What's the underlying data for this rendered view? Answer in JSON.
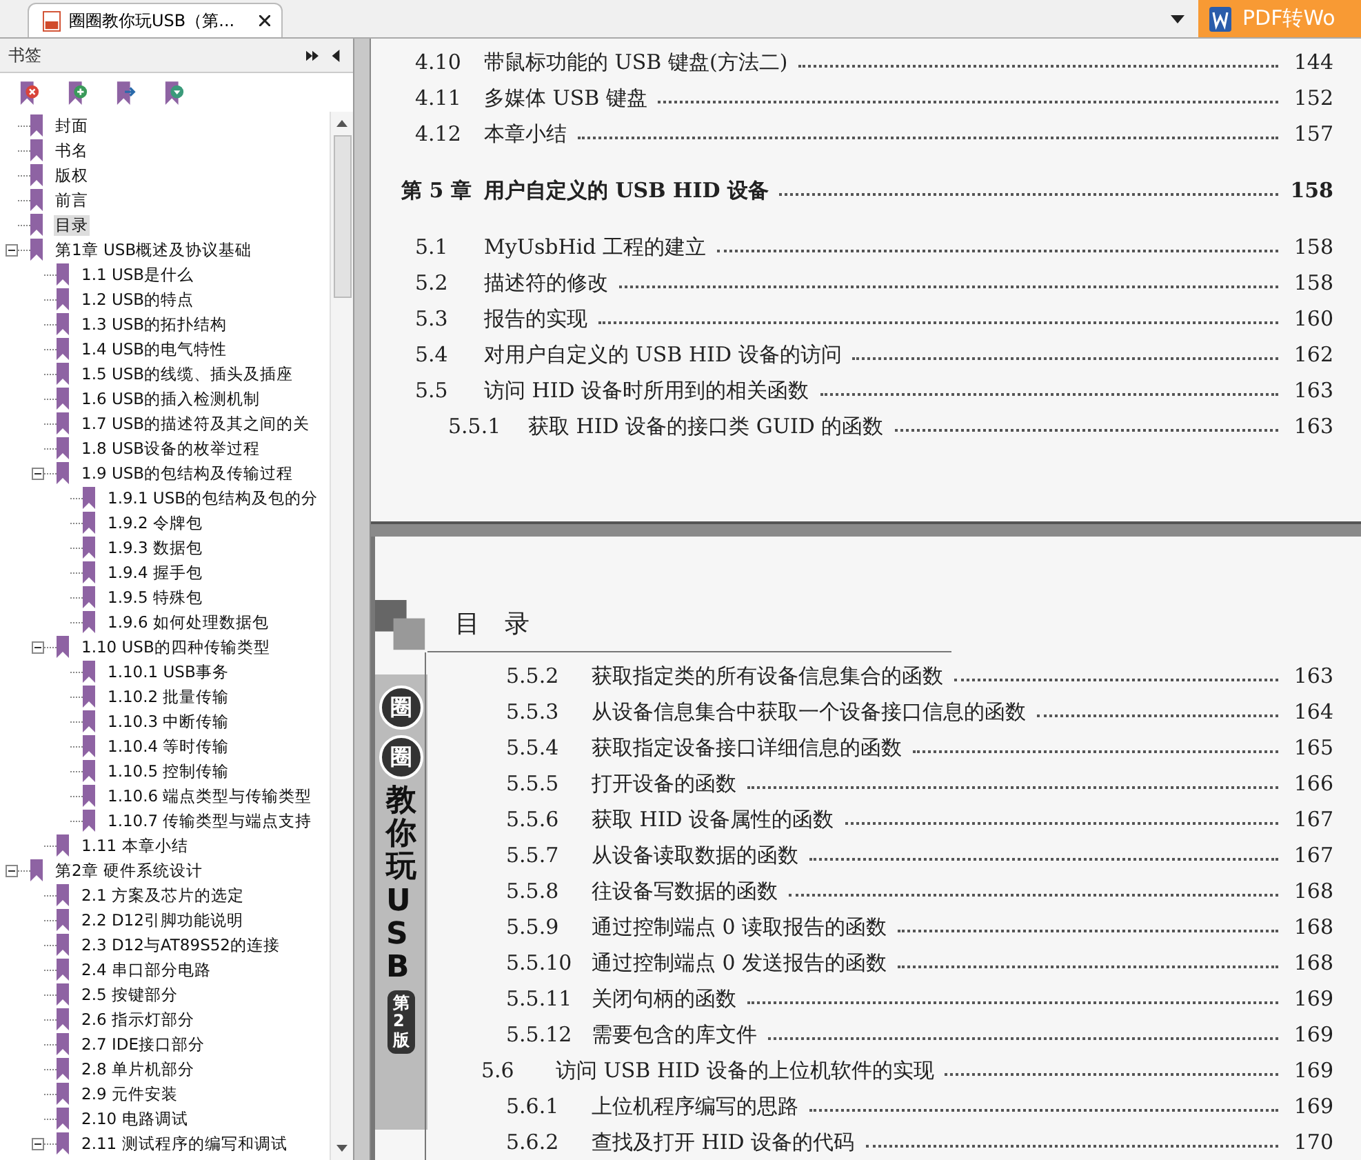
{
  "tabs": [
    {
      "title": "圈圈教你玩USB（第...",
      "selected": true
    }
  ],
  "toolbar_button": {
    "label": "PDF转Wo"
  },
  "bookmarks_panel": {
    "title": "书签",
    "items": [
      {
        "label": "封面",
        "selected": false
      },
      {
        "label": "书名",
        "selected": false
      },
      {
        "label": "版权",
        "selected": false
      },
      {
        "label": "前言",
        "selected": false
      },
      {
        "label": "目录",
        "selected": true
      },
      {
        "label": "第1章 USB概述及协议基础",
        "selected": false,
        "expanded": true,
        "children": [
          {
            "label": "1.1 USB是什么",
            "selected": false
          },
          {
            "label": "1.2 USB的特点",
            "selected": false
          },
          {
            "label": "1.3 USB的拓扑结构",
            "selected": false
          },
          {
            "label": "1.4 USB的电气特性",
            "selected": false
          },
          {
            "label": "1.5 USB的线缆、插头及插座",
            "selected": false
          },
          {
            "label": "1.6 USB的插入检测机制",
            "selected": false
          },
          {
            "label": "1.7 USB的描述符及其之间的关",
            "selected": false
          },
          {
            "label": "1.8 USB设备的枚举过程",
            "selected": false
          },
          {
            "label": "1.9 USB的包结构及传输过程",
            "selected": false,
            "expanded": true,
            "children": [
              {
                "label": "1.9.1 USB的包结构及包的分",
                "selected": false
              },
              {
                "label": "1.9.2 令牌包",
                "selected": false
              },
              {
                "label": "1.9.3 数据包",
                "selected": false
              },
              {
                "label": "1.9.4 握手包",
                "selected": false
              },
              {
                "label": "1.9.5 特殊包",
                "selected": false
              },
              {
                "label": "1.9.6 如何处理数据包",
                "selected": false
              }
            ]
          },
          {
            "label": "1.10 USB的四种传输类型",
            "selected": false,
            "expanded": true,
            "children": [
              {
                "label": "1.10.1 USB事务",
                "selected": false
              },
              {
                "label": "1.10.2 批量传输",
                "selected": false
              },
              {
                "label": "1.10.3 中断传输",
                "selected": false
              },
              {
                "label": "1.10.4 等时传输",
                "selected": false
              },
              {
                "label": "1.10.5 控制传输",
                "selected": false
              },
              {
                "label": "1.10.6 端点类型与传输类型",
                "selected": false
              },
              {
                "label": "1.10.7 传输类型与端点支持",
                "selected": false
              }
            ]
          },
          {
            "label": "1.11 本章小结",
            "selected": false
          }
        ]
      },
      {
        "label": "第2章 硬件系统设计",
        "selected": false,
        "expanded": true,
        "children": [
          {
            "label": "2.1 方案及芯片的选定",
            "selected": false
          },
          {
            "label": "2.2 D12引脚功能说明",
            "selected": false
          },
          {
            "label": "2.3 D12与AT89S52的连接",
            "selected": false
          },
          {
            "label": "2.4 串口部分电路",
            "selected": false
          },
          {
            "label": "2.5 按键部分",
            "selected": false
          },
          {
            "label": "2.6 指示灯部分",
            "selected": false
          },
          {
            "label": "2.7 IDE接口部分",
            "selected": false
          },
          {
            "label": "2.8 单片机部分",
            "selected": false
          },
          {
            "label": "2.9 元件安装",
            "selected": false
          },
          {
            "label": "2.10 电路调试",
            "selected": false
          },
          {
            "label": "2.11 测试程序的编写和调试",
            "selected": false,
            "expanded": true
          }
        ]
      }
    ]
  },
  "pages": [
    {
      "entries": [
        {
          "kind": "section",
          "number": "4.10",
          "title": "带鼠标功能的 USB 键盘(方法二)",
          "page": "144"
        },
        {
          "kind": "section",
          "number": "4.11",
          "title": "多媒体 USB 键盘",
          "page": "152"
        },
        {
          "kind": "section",
          "number": "4.12",
          "title": "本章小结",
          "page": "157"
        },
        {
          "kind": "chapter",
          "number": "第 5 章",
          "title": "用户自定义的 USB HID 设备",
          "page": "158"
        },
        {
          "kind": "section",
          "number": "5.1",
          "title": "MyUsbHid 工程的建立",
          "page": "158"
        },
        {
          "kind": "section",
          "number": "5.2",
          "title": "描述符的修改",
          "page": "158"
        },
        {
          "kind": "section",
          "number": "5.3",
          "title": "报告的实现",
          "page": "160"
        },
        {
          "kind": "section",
          "number": "5.4",
          "title": "对用户自定义的 USB HID 设备的访问",
          "page": "162"
        },
        {
          "kind": "section",
          "number": "5.5",
          "title": "访问 HID 设备时所用到的相关函数",
          "page": "163"
        },
        {
          "kind": "subsection",
          "number": "5.5.1",
          "title": "获取 HID 设备的接口类 GUID 的函数",
          "page": "163"
        }
      ]
    },
    {
      "header": "目　录",
      "spine": {
        "logo": [
          "圈",
          "圈"
        ],
        "title": "教你玩USB",
        "edition": "第2版"
      },
      "entries": [
        {
          "kind": "subsection",
          "number": "5.5.2",
          "title": "获取指定类的所有设备信息集合的函数",
          "page": "163"
        },
        {
          "kind": "subsection",
          "number": "5.5.3",
          "title": "从设备信息集合中获取一个设备接口信息的函数",
          "page": "164"
        },
        {
          "kind": "subsection",
          "number": "5.5.4",
          "title": "获取指定设备接口详细信息的函数",
          "page": "165"
        },
        {
          "kind": "subsection",
          "number": "5.5.5",
          "title": "打开设备的函数",
          "page": "166"
        },
        {
          "kind": "subsection",
          "number": "5.5.6",
          "title": "获取 HID 设备属性的函数",
          "page": "167"
        },
        {
          "kind": "subsection",
          "number": "5.5.7",
          "title": "从设备读取数据的函数",
          "page": "167"
        },
        {
          "kind": "subsection",
          "number": "5.5.8",
          "title": "往设备写数据的函数",
          "page": "168"
        },
        {
          "kind": "subsection",
          "number": "5.5.9",
          "title": "通过控制端点 0 读取报告的函数",
          "page": "168"
        },
        {
          "kind": "subsection",
          "number": "5.5.10",
          "title": "通过控制端点 0 发送报告的函数",
          "page": "168"
        },
        {
          "kind": "subsection",
          "number": "5.5.11",
          "title": "关闭句柄的函数",
          "page": "169"
        },
        {
          "kind": "subsection",
          "number": "5.5.12",
          "title": "需要包含的库文件",
          "page": "169"
        },
        {
          "kind": "section",
          "number": "5.6",
          "title": "访问 USB HID 设备的上位机软件的实现",
          "page": "169"
        },
        {
          "kind": "subsection",
          "number": "5.6.1",
          "title": "上位机程序编写的思路",
          "page": "169"
        },
        {
          "kind": "subsection",
          "number": "5.6.2",
          "title": "查找及打开 HID 设备的代码",
          "page": "170"
        }
      ]
    }
  ]
}
